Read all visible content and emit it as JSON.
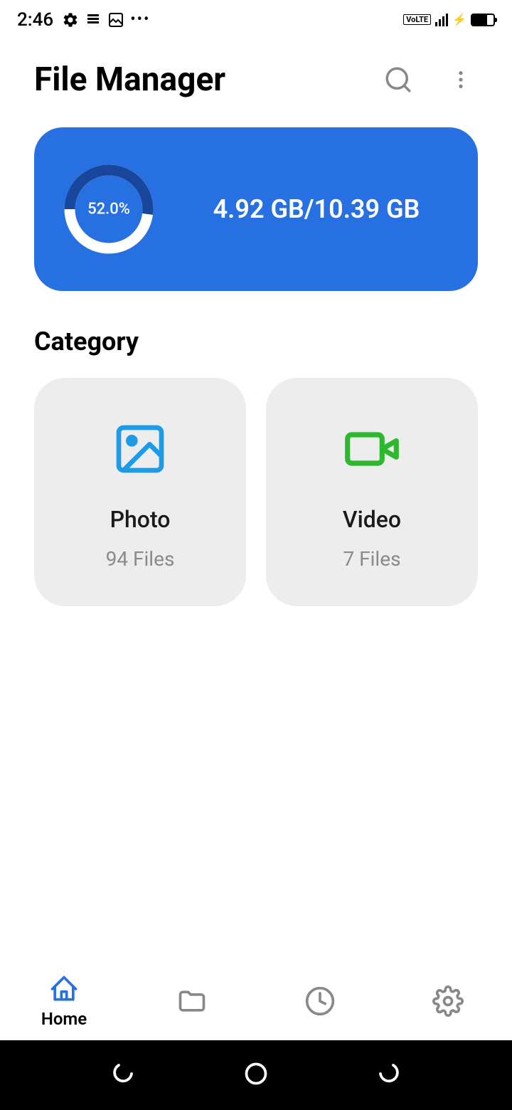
{
  "status_bar": {
    "time": "2:46",
    "volte": "VoLTE"
  },
  "header": {
    "title": "File Manager"
  },
  "storage": {
    "percentage": "52.0%",
    "used_total": "4.92 GB/10.39 GB"
  },
  "section": {
    "category_label": "Category"
  },
  "categories": [
    {
      "title": "Photo",
      "count": "94 Files"
    },
    {
      "title": "Video",
      "count": "7 Files"
    }
  ],
  "bottom_nav": {
    "home_label": "Home"
  }
}
